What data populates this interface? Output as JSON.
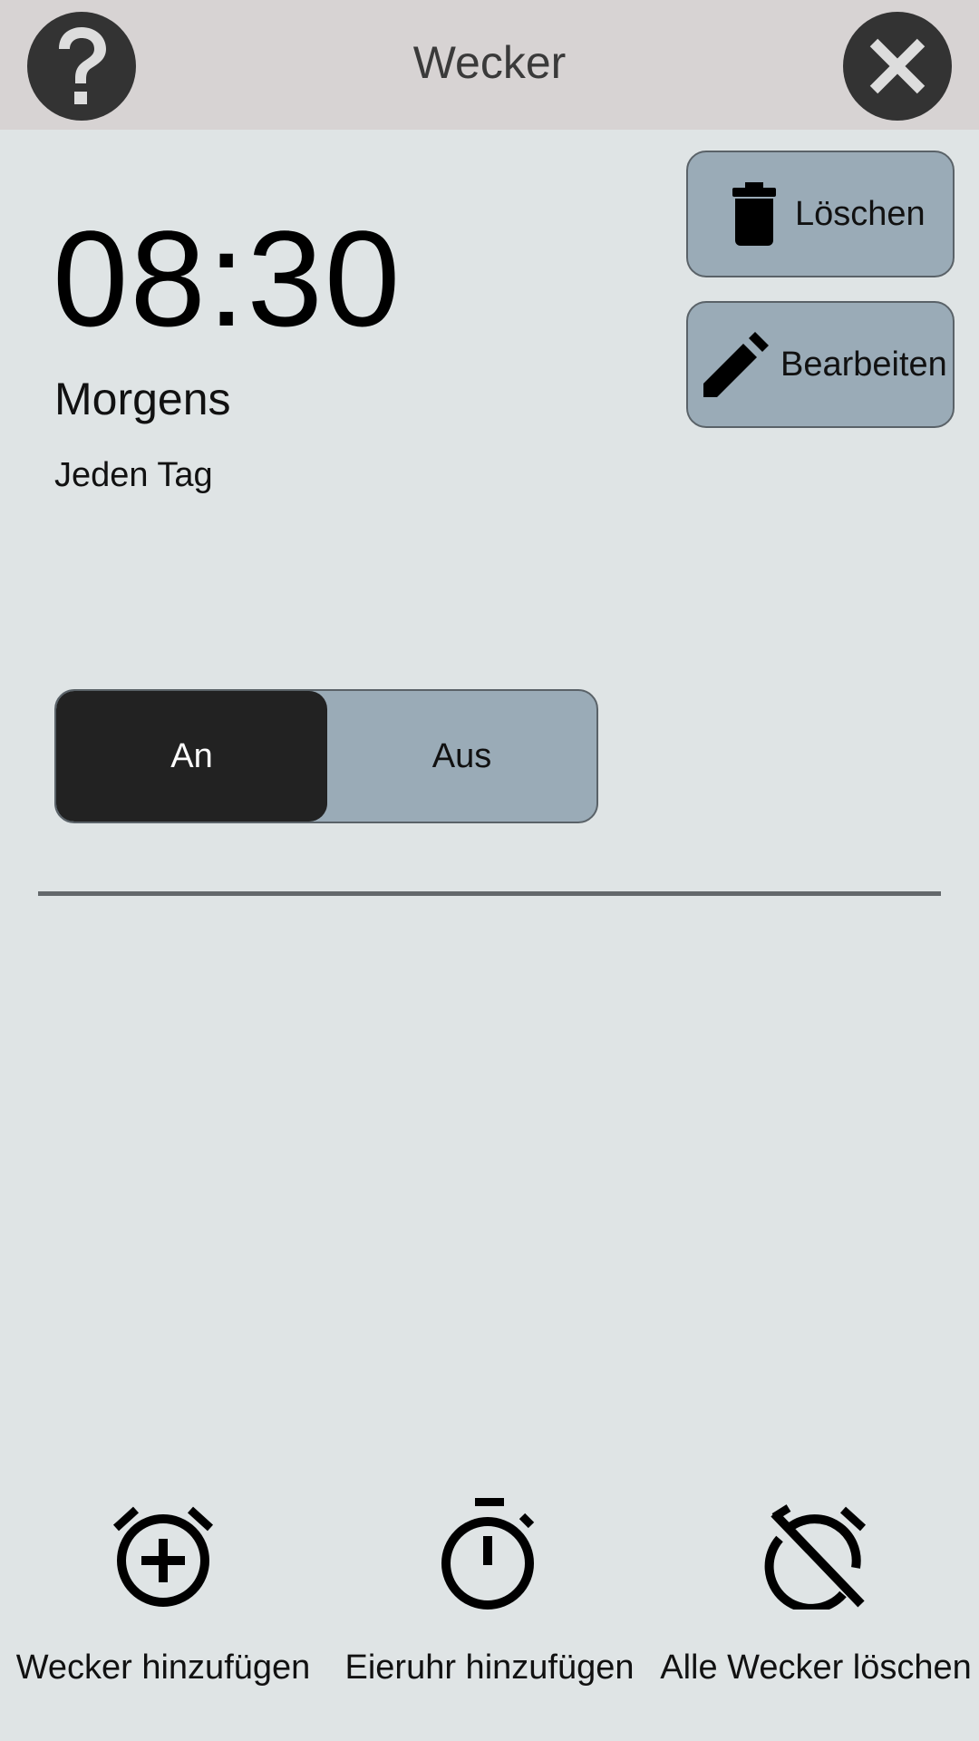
{
  "header": {
    "title": "Wecker",
    "help_icon": "help-icon",
    "close_icon": "close-icon"
  },
  "alarm": {
    "time": "08:30",
    "name": "Morgens",
    "repeat": "Jeden Tag",
    "enabled": true,
    "toggle": {
      "on_label": "An",
      "off_label": "Aus"
    },
    "delete_label": "Löschen",
    "edit_label": "Bearbeiten",
    "delete_icon": "trash-icon",
    "edit_icon": "pencil-icon"
  },
  "bottom_bar": {
    "add_alarm_label": "Wecker hinzufügen",
    "add_timer_label": "Eieruhr hinzufügen",
    "delete_all_label": "Alle Wecker löschen",
    "add_alarm_icon": "alarm-add-icon",
    "add_timer_icon": "stopwatch-icon",
    "delete_all_icon": "alarm-off-icon"
  },
  "colors": {
    "header_bg": "#d7d3d3",
    "page_bg": "#dfe4e5",
    "button_bg": "#9aabb7",
    "toggle_active_bg": "#222222",
    "round_button_bg": "#333333"
  }
}
